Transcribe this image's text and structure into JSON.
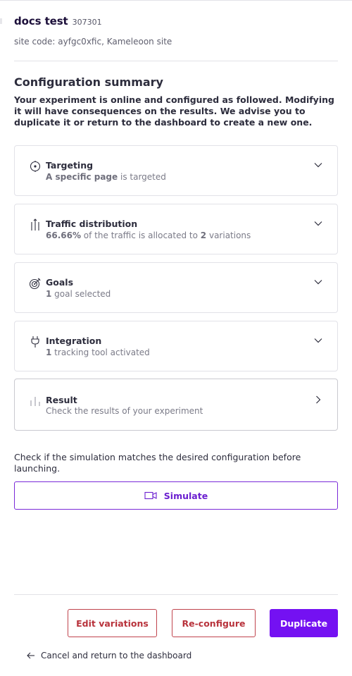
{
  "header": {
    "title": "docs test",
    "experiment_id": "307301",
    "site_code": "site code: ayfgc0xfic, Kameleoon site"
  },
  "summary": {
    "title": "Configuration summary",
    "intro": "Your experiment is online and configured as followed. Modifying it will have consequences on the results. We advise you to duplicate it or return to the dashboard to create a new one."
  },
  "cards": {
    "targeting": {
      "title": "Targeting",
      "highlight": "A specific page",
      "rest": " is targeted",
      "icon": "target-page-icon"
    },
    "traffic": {
      "title": "Traffic distribution",
      "percent": "66.66%",
      "middle": " of the traffic is allocated to ",
      "count": "2",
      "end": " variations",
      "icon": "traffic-split-icon"
    },
    "goals": {
      "title": "Goals",
      "count": "1",
      "rest": " goal selected",
      "icon": "goal-target-icon"
    },
    "integration": {
      "title": "Integration",
      "count": "1",
      "rest": " tracking tool activated",
      "icon": "plug-icon"
    },
    "result": {
      "title": "Result",
      "subtitle": "Check the results of your experiment",
      "icon": "bar-chart-icon"
    }
  },
  "simulation": {
    "note": "Check if the simulation matches the desired configuration before launching.",
    "button_label": "Simulate",
    "icon": "video-camera-icon"
  },
  "footer": {
    "edit_label": "Edit variations",
    "reconfigure_label": "Re-configure",
    "duplicate_label": "Duplicate",
    "cancel_label": "Cancel and return to the dashboard"
  },
  "colors": {
    "primary": "#7411f2",
    "danger": "#b8333c",
    "title": "#1c0f3a"
  }
}
